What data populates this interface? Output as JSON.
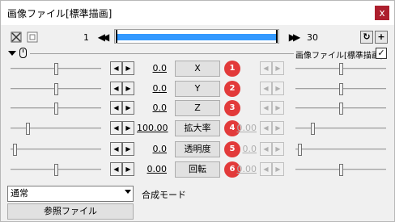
{
  "window": {
    "title": "画像ファイル[標準描画]",
    "close_glyph": "x"
  },
  "toolbar": {
    "start_frame": "1",
    "end_frame": "30",
    "prev_glyph": "◀◀",
    "next_glyph": "▶▶",
    "refresh_glyph": "↻",
    "add_glyph": "+",
    "timeline_progress": 1.0,
    "accent_color": "#3399ff"
  },
  "header": {
    "object_label": "画像ファイル[標準描画]",
    "checked": "✓"
  },
  "params": [
    {
      "name": "X",
      "value": "0.0",
      "end_value": "",
      "badge": "1",
      "left_pos": 0.5,
      "right_pos": 0.5
    },
    {
      "name": "Y",
      "value": "0.0",
      "end_value": "",
      "badge": "2",
      "left_pos": 0.5,
      "right_pos": 0.5
    },
    {
      "name": "Z",
      "value": "0.0",
      "end_value": "",
      "badge": "3",
      "left_pos": 0.5,
      "right_pos": 0.5
    },
    {
      "name": "拡大率",
      "value": "100.00",
      "end_value": "0.00",
      "badge": "4",
      "left_pos": 0.18,
      "right_pos": 0.18
    },
    {
      "name": "透明度",
      "value": "0.0",
      "end_value": "0.0",
      "badge": "5",
      "left_pos": 0.03,
      "right_pos": 0.03
    },
    {
      "name": "回転",
      "value": "0.00",
      "end_value": "0.00",
      "badge": "6",
      "left_pos": 0.5,
      "right_pos": 0.5
    }
  ],
  "spin": {
    "left": "◀",
    "right": "▶"
  },
  "blend": {
    "selected": "通常",
    "label": "合成モード"
  },
  "reference_button": "参照ファイル",
  "badge_color": "#e23a3a"
}
